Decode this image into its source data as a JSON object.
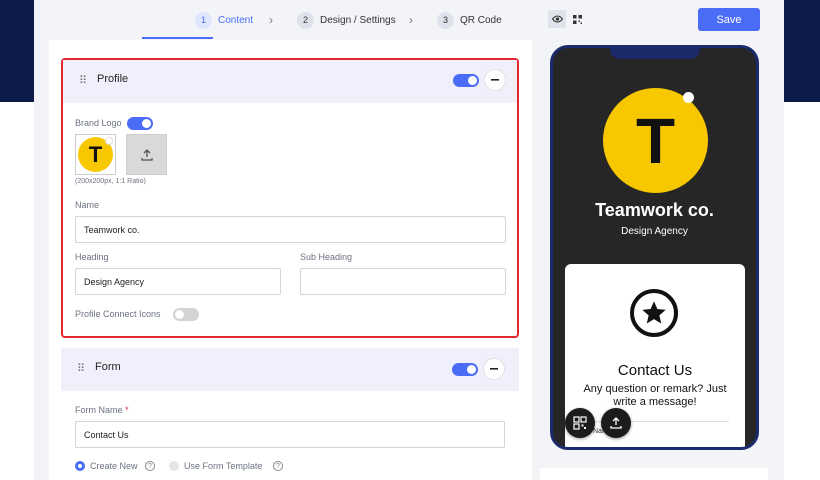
{
  "stepper": {
    "steps": [
      {
        "num": "1",
        "label": "Content",
        "active": true
      },
      {
        "num": "2",
        "label": "Design / Settings",
        "active": false
      },
      {
        "num": "3",
        "label": "QR Code",
        "active": false
      }
    ]
  },
  "profile": {
    "title": "Profile",
    "enabled": true,
    "brand_logo_label": "Brand Logo",
    "brand_logo_enabled": true,
    "logo_letter": "T",
    "logo_hint": "(200x200px, 1:1 Ratio)",
    "name_label": "Name",
    "name_value": "Teamwork co.",
    "heading_label": "Heading",
    "heading_value": "Design Agency",
    "subheading_label": "Sub Heading",
    "subheading_value": "",
    "connect_icons_label": "Profile Connect Icons",
    "connect_icons_enabled": false
  },
  "form": {
    "title": "Form",
    "enabled": true,
    "name_label": "Form Name",
    "required_mark": "*",
    "name_value": "Contact Us",
    "radio_create": "Create New",
    "radio_template": "Use Form Template",
    "selected": "Create New"
  },
  "toolbar": {
    "save_label": "Save",
    "view_icons": [
      "eye-icon",
      "qr-code-icon"
    ]
  },
  "preview": {
    "logo_letter": "T",
    "name": "Teamwork co.",
    "heading": "Design Agency",
    "contact_title": "Contact Us",
    "contact_desc": "Any question or remark? Just write a message!",
    "name_field_label": "Nam"
  },
  "colors": {
    "accent": "#4b6cf7",
    "navy": "#0d1b4b",
    "logo_yellow": "#f7c800",
    "highlight_border": "#e3262e",
    "phone_bg": "#262626"
  }
}
